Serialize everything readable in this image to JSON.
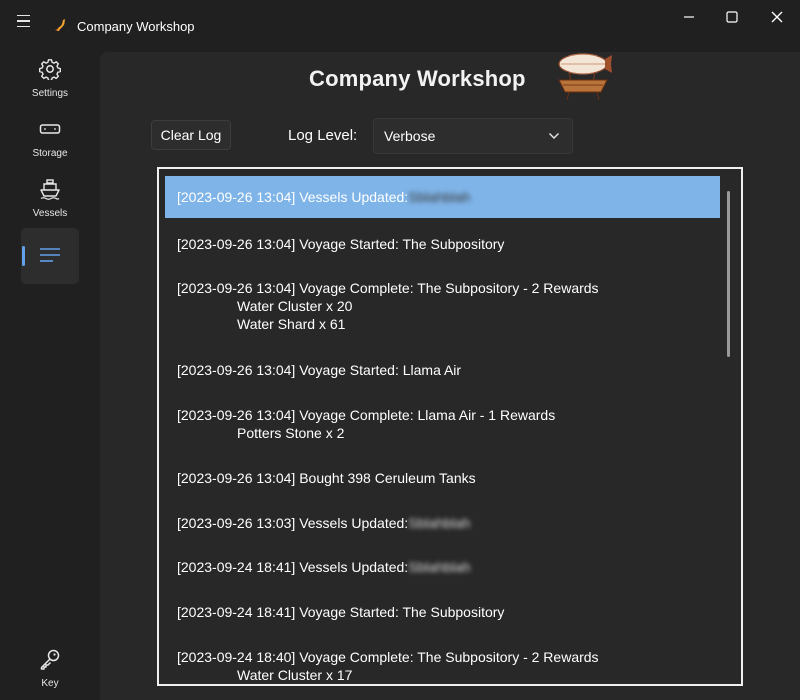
{
  "window": {
    "title": "Company Workshop",
    "colors": {
      "background": "#202020",
      "content": "#282828",
      "accent": "#62a0ea",
      "selected_row": "#7fb4e8"
    }
  },
  "nav": {
    "items": [
      {
        "label": "Settings",
        "icon": "gear-icon"
      },
      {
        "label": "Storage",
        "icon": "storage-icon"
      },
      {
        "label": "Vessels",
        "icon": "ship-icon"
      },
      {
        "label": "",
        "icon": "log-lines-icon",
        "selected": true
      }
    ],
    "footer": {
      "label": "Key",
      "icon": "key-icon"
    }
  },
  "page": {
    "title": "Company Workshop",
    "clear_button": "Clear Log",
    "log_level_label": "Log Level:",
    "log_level_value": "Verbose"
  },
  "log": {
    "entries": [
      {
        "text": "[2023-09-26 13:04] Vessels Updated:",
        "redacted": "Sblahblah",
        "details": [],
        "selected": true
      },
      {
        "text": "[2023-09-26 13:04] Voyage Started: The Subpository",
        "details": []
      },
      {
        "text": "[2023-09-26 13:04] Voyage Complete: The Subpository - 2 Rewards",
        "details": [
          "Water Cluster x 20",
          "Water Shard x 61"
        ]
      },
      {
        "text": "[2023-09-26 13:04] Voyage Started: Llama Air",
        "details": []
      },
      {
        "text": "[2023-09-26 13:04] Voyage Complete: Llama Air - 1 Rewards",
        "details": [
          "Potters Stone x 2"
        ]
      },
      {
        "text": "[2023-09-26 13:04] Bought 398 Ceruleum Tanks",
        "details": []
      },
      {
        "text": "[2023-09-26 13:03] Vessels Updated:",
        "redacted": "Sblahblah",
        "details": []
      },
      {
        "text": "[2023-09-24 18:41] Vessels Updated:",
        "redacted": "Sblahblah",
        "details": []
      },
      {
        "text": "[2023-09-24 18:41] Voyage Started: The Subpository",
        "details": []
      },
      {
        "text": "[2023-09-24 18:40] Voyage Complete: The Subpository - 2 Rewards",
        "details": [
          "Water Cluster x 17"
        ]
      }
    ]
  }
}
